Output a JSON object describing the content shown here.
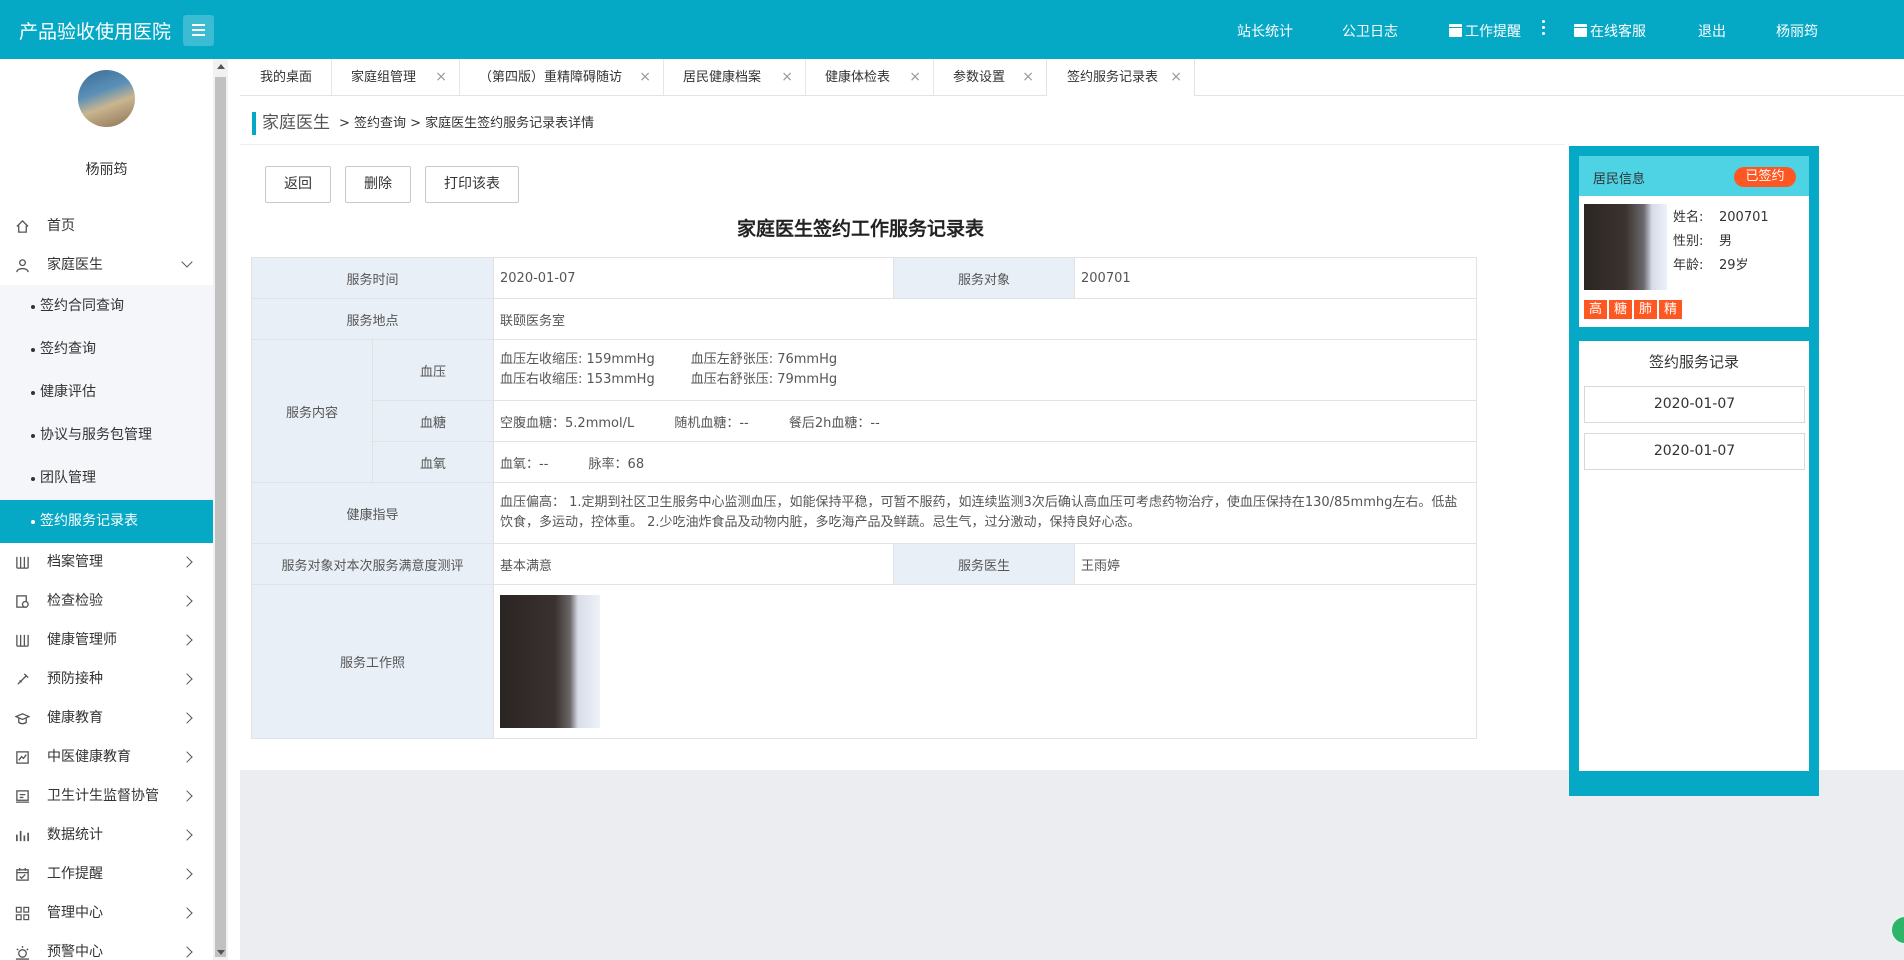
{
  "app": {
    "title": "产品验收使用医院"
  },
  "header": {
    "nav": [
      "站长统计",
      "公卫日志",
      "工作提醒",
      "在线客服",
      "退出",
      "杨丽筠"
    ]
  },
  "user": {
    "name": "杨丽筠"
  },
  "sidebar": {
    "items": [
      {
        "label": "首页",
        "icon": "home-icon"
      },
      {
        "label": "家庭医生",
        "icon": "doctor-icon"
      },
      {
        "label": "档案管理",
        "icon": "archive-icon"
      },
      {
        "label": "检查检验",
        "icon": "inspect-icon"
      },
      {
        "label": "健康管理师",
        "icon": "manager-icon"
      },
      {
        "label": "预防接种",
        "icon": "syringe-icon"
      },
      {
        "label": "健康教育",
        "icon": "education-icon"
      },
      {
        "label": "中医健康教育",
        "icon": "tcm-icon"
      },
      {
        "label": "卫生计生监督协管",
        "icon": "supervise-icon"
      },
      {
        "label": "数据统计",
        "icon": "chart-icon"
      },
      {
        "label": "工作提醒",
        "icon": "reminder-icon"
      },
      {
        "label": "管理中心",
        "icon": "grid-icon"
      },
      {
        "label": "预警中心",
        "icon": "alert-icon"
      }
    ],
    "subitems": [
      "签约合同查询",
      "签约查询",
      "健康评估",
      "协议与服务包管理",
      "团队管理",
      "签约服务记录表"
    ]
  },
  "tabs": [
    "我的桌面",
    "家庭组管理",
    "（第四版）重精障碍随访",
    "居民健康档案",
    "健康体检表",
    "参数设置",
    "签约服务记录表"
  ],
  "breadcrumb": {
    "root": "家庭医生",
    "path": "> 签约查询 > 家庭医生签约服务记录表详情"
  },
  "buttons": {
    "back": "返回",
    "delete": "删除",
    "print": "打印该表"
  },
  "record": {
    "title": "家庭医生签约工作服务记录表",
    "service_time_label": "服务时间",
    "service_time": "2020-01-07",
    "service_target_label": "服务对象",
    "service_target": "200701",
    "service_place_label": "服务地点",
    "service_place": "联颐医务室",
    "service_content_label": "服务内容",
    "bp_label": "血压",
    "bp_left_sys": "血压左收缩压: 159mmHg",
    "bp_left_dia": "血压左舒张压: 76mmHg",
    "bp_right_sys": "血压右收缩压: 153mmHg",
    "bp_right_dia": "血压右舒张压: 79mmHg",
    "glucose_label": "血糖",
    "glucose_fasting": "空腹血糖：5.2mmol/L",
    "glucose_random": "随机血糖：--",
    "glucose_post": "餐后2h血糖：--",
    "oxygen_label": "血氧",
    "oxygen": "血氧：--",
    "pulse": "脉率：68",
    "guidance_label": "健康指导",
    "guidance": "血压偏高： 1.定期到社区卫生服务中心监测血压，如能保持平稳，可暂不服药，如连续监测3次后确认高血压可考虑药物治疗，使血压保持在130/85mmhg左右。低盐饮食，多运动，控体重。 2.少吃油炸食品及动物内脏，多吃海产品及鲜蔬。忌生气，过分激动，保持良好心态。",
    "satisfaction_label": "服务对象对本次服务满意度测评",
    "satisfaction": "基本满意",
    "doctor_label": "服务医生",
    "doctor": "王雨婷",
    "photo_label": "服务工作照"
  },
  "resident": {
    "header": "居民信息",
    "status": "已签约",
    "name_label": "姓名:",
    "name": "200701",
    "gender_label": "性别:",
    "gender": "男",
    "age_label": "年龄:",
    "age": "29岁",
    "tags": [
      "高",
      "糖",
      "肺",
      "精"
    ]
  },
  "records_panel": {
    "title": "签约服务记录",
    "dates": [
      "2020-01-07",
      "2020-01-07"
    ]
  },
  "colors": {
    "accent": "#05a9c6",
    "tag": "#ff5722",
    "label_bg": "#e9eff6"
  }
}
